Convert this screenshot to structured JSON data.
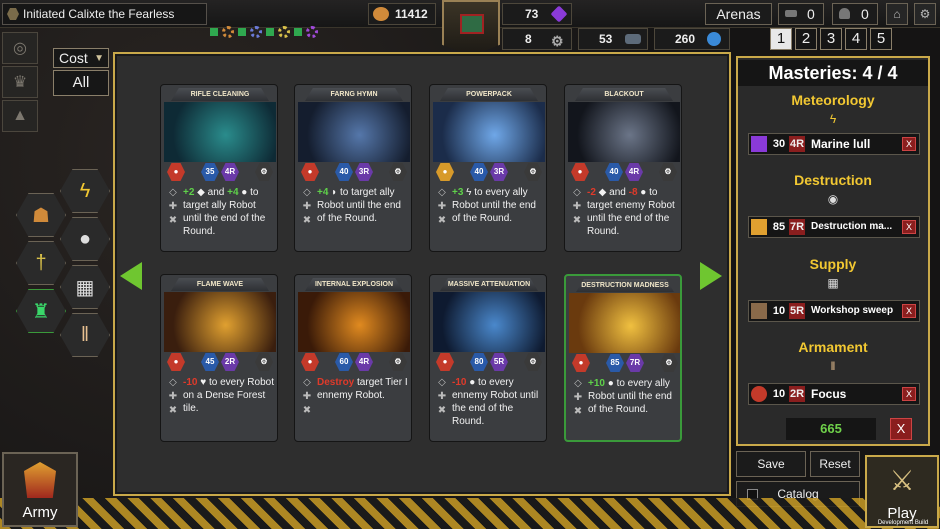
{
  "header": {
    "player_title": "Initiated Calixte the Fearless",
    "gold": "11412",
    "crystals": "73",
    "gears": "8",
    "ore": "53",
    "cores": "260",
    "arenas_label": "Arenas",
    "arena_count_1": "0",
    "arena_count_2": "0",
    "pages": [
      "1",
      "2",
      "3",
      "4",
      "5"
    ],
    "active_page": "1"
  },
  "filters": {
    "sort_label": "Cost",
    "filter_label": "All"
  },
  "cards": [
    {
      "name": "Rifle cleaning",
      "cost": "35",
      "rank": "4R",
      "text": [
        [
          "g",
          "+2"
        ],
        [
          "n",
          " ◆ and "
        ],
        [
          "g",
          "+4"
        ],
        [
          "n",
          " ● to target ally Robot until the end of the Round."
        ]
      ],
      "art": "#2a8c8c",
      "art2": "#0e2a35",
      "icon": "#c43a2a"
    },
    {
      "name": "Farng hymn",
      "cost": "40",
      "rank": "3R",
      "text": [
        [
          "g",
          "+4"
        ],
        [
          "n",
          " ◗ to target ally Robot until the end of the Round."
        ]
      ],
      "art": "#5577aa",
      "art2": "#141d2e",
      "icon": "#c43a2a"
    },
    {
      "name": "Powerpack",
      "cost": "40",
      "rank": "3R",
      "text": [
        [
          "g",
          "+3"
        ],
        [
          "n",
          " ϟ to every ally Robot until the end of the Round."
        ]
      ],
      "art": "#6fa7e8",
      "art2": "#1b2c4a",
      "icon": "#d79a2a"
    },
    {
      "name": "Blackout",
      "cost": "40",
      "rank": "4R",
      "text": [
        [
          "r",
          "-2"
        ],
        [
          "n",
          " ◆ and "
        ],
        [
          "r",
          "-8"
        ],
        [
          "n",
          " ● to target enemy Robot until the end of the Round."
        ]
      ],
      "art": "#6b7588",
      "art2": "#12151c",
      "icon": "#c43a2a"
    },
    {
      "name": "Flame wave",
      "cost": "45",
      "rank": "2R",
      "text": [
        [
          "r",
          "-10"
        ],
        [
          "n",
          " ♥ to every Robot on a Dense Forest tile."
        ]
      ],
      "art": "#e0a030",
      "art2": "#3a1e0e",
      "icon": "#c43a2a"
    },
    {
      "name": "Internal explosion",
      "cost": "60",
      "rank": "4R",
      "text": [
        [
          "r",
          "Destroy"
        ],
        [
          "n",
          " target Tier I ennemy Robot."
        ]
      ],
      "art": "#e08a20",
      "art2": "#3a1a08",
      "icon": "#c43a2a"
    },
    {
      "name": "Massive attenuation",
      "cost": "80",
      "rank": "5R",
      "text": [
        [
          "r",
          "-10"
        ],
        [
          "n",
          " ● to every ennemy Robot until the end of the Round."
        ]
      ],
      "art": "#4a88cc",
      "art2": "#0e1a30",
      "icon": "#c43a2a"
    },
    {
      "name": "Destruction madness",
      "cost": "85",
      "rank": "7R",
      "text": [
        [
          "g",
          "+10"
        ],
        [
          "n",
          " ● to every ally Robot until the end of the Round."
        ]
      ],
      "art": "#f0c040",
      "art2": "#6a3a0e",
      "icon": "#c43a2a"
    }
  ],
  "masteries": {
    "title": "Masteries: 4 / 4",
    "categories": [
      {
        "name": "Meteorology",
        "icon": "ϟ",
        "item": {
          "cost": "30",
          "rank": "4R",
          "label": "Marine lull",
          "thumb": "#8a3ad8"
        }
      },
      {
        "name": "Destruction",
        "icon": "◉",
        "item": {
          "cost": "85",
          "rank": "7R",
          "label": "Destruction ma...",
          "thumb": "#e0a030"
        }
      },
      {
        "name": "Supply",
        "icon": "▦",
        "item": {
          "cost": "10",
          "rank": "5R",
          "label": "Workshop sweep",
          "thumb": "#8a6a4a"
        }
      },
      {
        "name": "Armament",
        "icon": "‖",
        "item": {
          "cost": "10",
          "rank": "2R",
          "label": "Focus",
          "thumb": "#c43a2a"
        }
      }
    ],
    "total": "665",
    "remove_label": "X",
    "item_remove_label": "X"
  },
  "actions": {
    "save": "Save",
    "reset": "Reset",
    "catalog": "Catalog",
    "army": "Army",
    "play": "Play",
    "dev_build": "Development Build"
  },
  "colors": {
    "accent_gold": "#c9a94a",
    "positive": "#5fd14a",
    "negative": "#e03a2a",
    "nav_arrow": "#6fc630"
  }
}
